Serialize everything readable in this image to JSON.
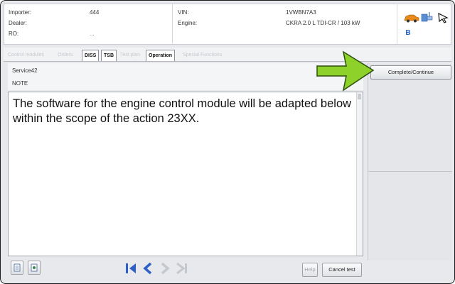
{
  "header": {
    "importer_label": "Importer:",
    "importer_value": "444",
    "dealer_label": "Dealer:",
    "ro_label": "RO:",
    "ro_value": "...",
    "vin_label": "VIN:",
    "vin_value": "1VWBN7A3",
    "engine_label": "Engine:",
    "engine_value": "CKRA 2.0 L TDI-CR / 103 kW",
    "bluetooth_text": "B"
  },
  "tabs": [
    {
      "label": "Control modules"
    },
    {
      "label": "Orders"
    },
    {
      "label": "DISS"
    },
    {
      "label": "TSB"
    },
    {
      "label": "Test plan"
    },
    {
      "label": "Operation"
    },
    {
      "label": "Special Functions"
    }
  ],
  "info": {
    "title": "Service42",
    "subtitle": "NOTE"
  },
  "message": {
    "text": "The software for the engine control module will be adapted below within the scope of the action 23XX."
  },
  "buttons": {
    "complete": "Complete/Continue",
    "help": "Help",
    "cancel": "Cancel test"
  },
  "colors": {
    "arrow_fill": "#8ed12a",
    "arrow_stroke": "#2d4f0a",
    "nav_blue": "#2e5fc7",
    "nav_disabled": "#c4c8cf"
  },
  "icons": {
    "vehicle": "car-icon",
    "network": "network-plug-icon",
    "diagnostic": "diagnostic-device-icon",
    "bluetooth": "bluetooth-icon"
  }
}
